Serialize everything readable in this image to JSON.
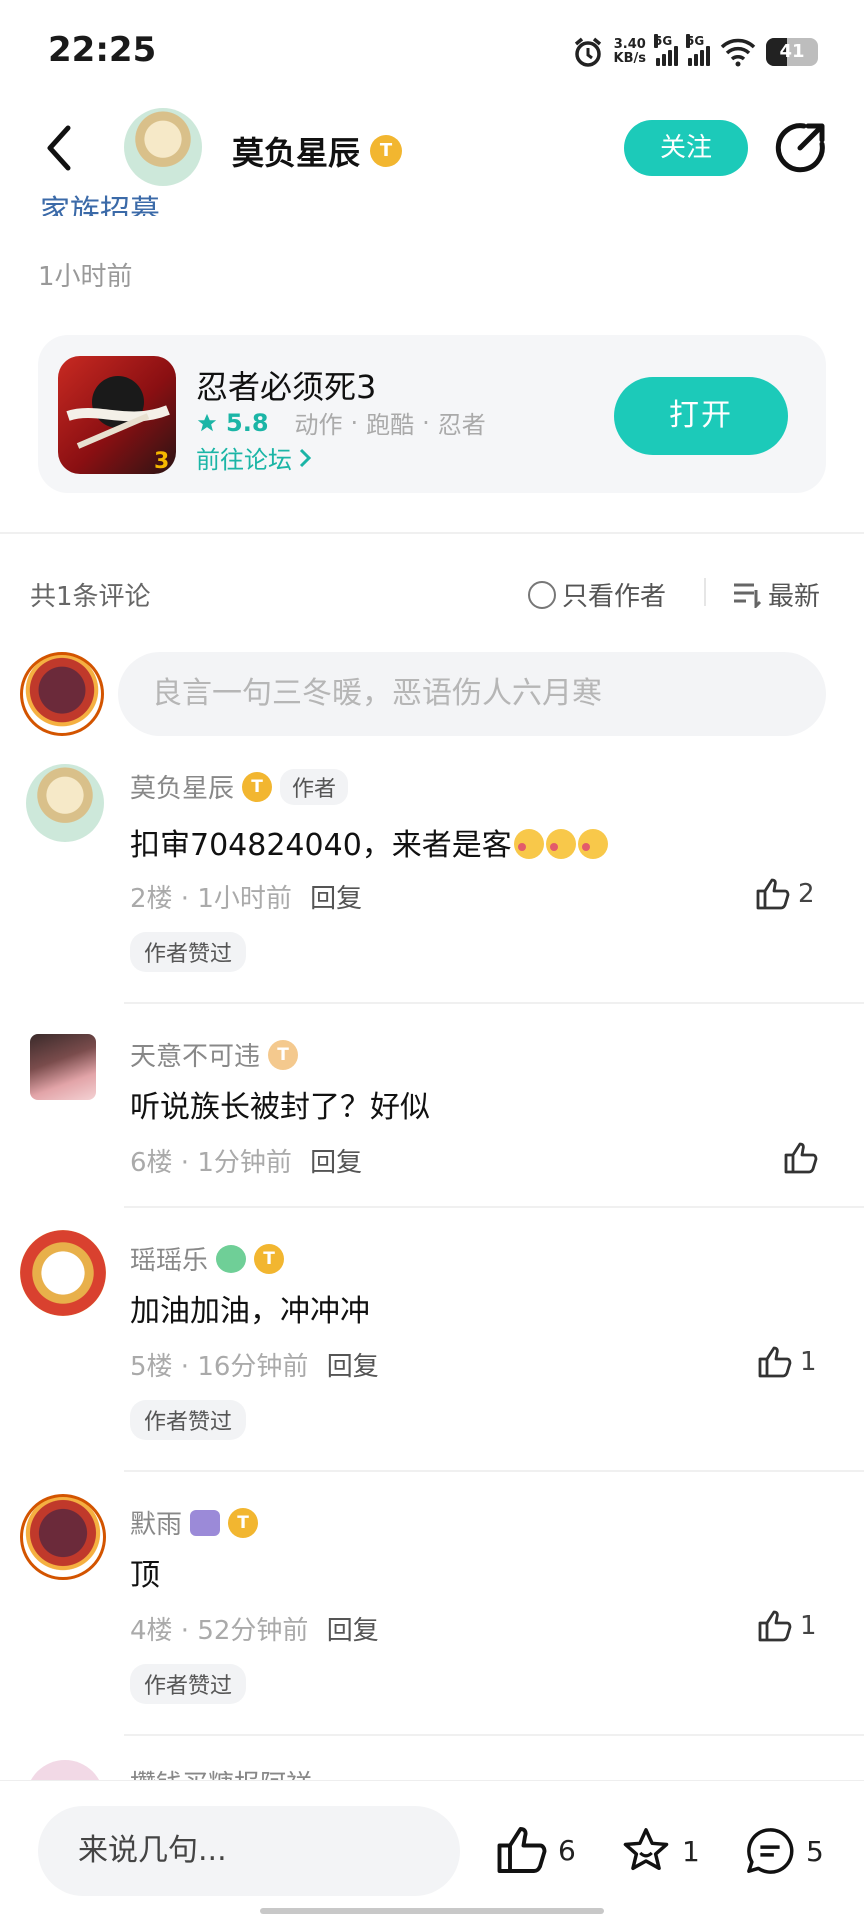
{
  "status_bar": {
    "time": "22:25",
    "net_speed_value": "3.40",
    "net_speed_unit": "KB/s",
    "sim1": "5G",
    "sim2": "5G",
    "battery": "41"
  },
  "header": {
    "author_name": "莫负星辰",
    "author_badge": "T",
    "follow_label": "关注"
  },
  "post": {
    "cut_text": "家族招募",
    "time": "1小时前"
  },
  "game_card": {
    "title": "忍者必须死3",
    "rating": "5.8",
    "tags": [
      "动作",
      "跑酷",
      "忍者"
    ],
    "forum_link": "前往论坛",
    "open_label": "打开"
  },
  "comments_header": {
    "total": "共1条评论",
    "only_author": "只看作者",
    "sort": "最新"
  },
  "compose": {
    "placeholder": "良言一句三冬暖，恶语伤人六月寒"
  },
  "comments": [
    {
      "name": "莫负星辰",
      "badge": "T",
      "author_tag": "作者",
      "text": "扣审704824040，来者是客",
      "floor": "2楼",
      "time": "1小时前",
      "reply": "回复",
      "likes": "2",
      "chip": "作者赞过"
    },
    {
      "name": "天意不可违",
      "badge": "T",
      "text": "听说族长被封了？好似",
      "floor": "6楼",
      "time": "1分钟前",
      "reply": "回复",
      "likes": ""
    },
    {
      "name": "瑶瑶乐",
      "badge": "T",
      "text": "加油加油，冲冲冲",
      "floor": "5楼",
      "time": "16分钟前",
      "reply": "回复",
      "likes": "1",
      "chip": "作者赞过"
    },
    {
      "name": "默雨",
      "badge": "T",
      "text": "顶",
      "floor": "4楼",
      "time": "52分钟前",
      "reply": "回复",
      "likes": "1",
      "chip": "作者赞过"
    },
    {
      "name": "攒钱买糖报阿祥"
    }
  ],
  "bottom_bar": {
    "input_placeholder": "来说几句...",
    "likes": "6",
    "favorites": "1",
    "comments": "5"
  },
  "colors": {
    "accent": "#1ccab9",
    "badge_gold": "#f2b630"
  }
}
